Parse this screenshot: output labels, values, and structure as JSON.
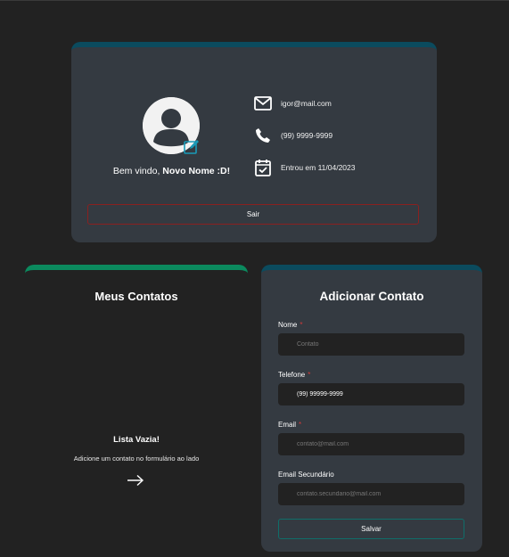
{
  "profile": {
    "welcome_prefix": "Bem vindo,",
    "user_name": "Novo Nome :D!",
    "email": "igor@mail.com",
    "phone": "(99) 9999-9999",
    "joined": "Entrou em 11/04/2023",
    "logout_label": "Sair"
  },
  "contacts": {
    "title": "Meus Contatos",
    "empty_title": "Lista Vazia!",
    "empty_subtitle": "Adicione um contato no formulário ao lado"
  },
  "form": {
    "title": "Adicionar Contato",
    "name": {
      "label": "Nome",
      "required_mark": "*",
      "value": "",
      "placeholder": "Contato"
    },
    "phone": {
      "label": "Telefone",
      "required_mark": "*",
      "value": "(99) 99999-9999",
      "placeholder": ""
    },
    "email": {
      "label": "Email",
      "required_mark": "*",
      "value": "",
      "placeholder": "contato@mail.com"
    },
    "email2": {
      "label": "Email Secundário",
      "value": "",
      "placeholder": "contato.secundario@mail.com"
    },
    "save_label": "Salvar"
  },
  "colors": {
    "background": "#222222",
    "card": "#343a41",
    "card_accent": "#0b4b5e",
    "contacts_accent": "#0b8a5e",
    "danger": "#8a2020",
    "required": "#d23a3a"
  },
  "icons": {
    "avatar": "user-avatar-icon",
    "edit": "edit-icon",
    "email": "envelope-icon",
    "phone": "phone-icon",
    "joined": "calendar-check-icon",
    "arrow": "arrow-right-icon"
  }
}
